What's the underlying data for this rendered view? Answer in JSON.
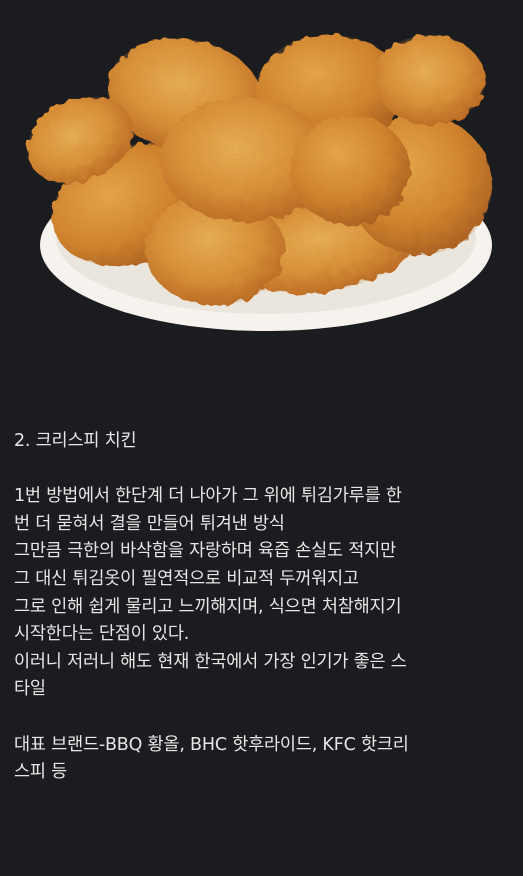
{
  "image": {
    "subject": "fried-chicken-plate-image"
  },
  "post": {
    "heading": "2. 크리스피 치킨",
    "para1": [
      "1번 방법에서 한단계 더 나아가 그 위에 튀김가루를 한",
      "번 더 묻혀서 결을 만들어 튀겨낸 방식",
      "그만큼 극한의 바삭함을 자랑하며 육즙 손실도 적지만",
      "그 대신 튀김옷이 필연적으로 비교적 두꺼워지고",
      "그로 인해 쉽게 물리고 느끼해지며, 식으면 처참해지기",
      "시작한다는 단점이 있다.",
      "이러니 저러니 해도 현재 한국에서 가장 인기가 좋은 스",
      "타일"
    ],
    "para2": [
      "대표 브랜드-BBQ 황올, BHC 핫후라이드, KFC 핫크리",
      "스피 등"
    ]
  },
  "colors": {
    "background": "#1b1c1f",
    "text": "#e6e6e6",
    "plate": "#f6f3ee",
    "chicken_light": "#f0a640",
    "chicken_dark": "#b8601a"
  }
}
